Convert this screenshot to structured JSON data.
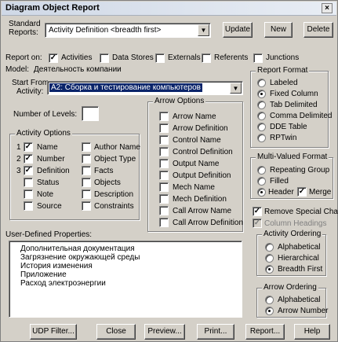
{
  "window": {
    "title": "Diagram Object Report",
    "close": "×"
  },
  "top": {
    "standard_reports_label_1": "Standard",
    "standard_reports_label_2": "Reports:",
    "standard_report_value": "Activity Definition <breadth first>",
    "update": "Update",
    "new": "New",
    "delete": "Delete"
  },
  "report_on": {
    "label": "Report on:",
    "activities": "Activities",
    "data_stores": "Data Stores",
    "externals": "Externals",
    "referents": "Referents",
    "junctions": "Junctions"
  },
  "model": {
    "label": "Model:",
    "value": "Деятельность компании"
  },
  "start_from": {
    "label_1": "Start From",
    "label_2": "Activity:",
    "value": "A2: Сборка и тестирование  компьютеров"
  },
  "levels": {
    "label": "Number of Levels:",
    "value": ""
  },
  "activity_options": {
    "title": "Activity Options",
    "left": [
      {
        "num": "1",
        "label": "Name",
        "checked": true
      },
      {
        "num": "2",
        "label": "Number",
        "checked": true
      },
      {
        "num": "3",
        "label": "Definition",
        "checked": true
      },
      {
        "num": "",
        "label": "Status",
        "checked": false
      },
      {
        "num": "",
        "label": "Note",
        "checked": false
      },
      {
        "num": "",
        "label": "Source",
        "checked": false
      }
    ],
    "right": [
      {
        "label": "Author Name",
        "checked": false
      },
      {
        "label": "Object Type",
        "checked": false
      },
      {
        "label": "Facts",
        "checked": false
      },
      {
        "label": "Objects",
        "checked": false
      },
      {
        "label": "Description",
        "checked": false
      },
      {
        "label": "Constraints",
        "checked": false
      }
    ]
  },
  "arrow_options": {
    "title": "Arrow Options",
    "items": [
      "Arrow Name",
      "Arrow Definition",
      "Control Name",
      "Control Definition",
      "Output Name",
      "Output Definition",
      "Mech Name",
      "Mech Definition",
      "Call Arrow Name",
      "Call Arrow Definition"
    ]
  },
  "report_format": {
    "title": "Report Format",
    "items": [
      "Labeled",
      "Fixed Column",
      "Tab Delimited",
      "Comma Delimited",
      "DDE Table",
      "RPTwin"
    ],
    "selected": "Fixed Column"
  },
  "multi_valued": {
    "title": "Multi-Valued Format",
    "items": [
      "Repeating Group",
      "Filled",
      "Header"
    ],
    "selected": "Header",
    "merge_label": "Merge",
    "merge_checked": true
  },
  "remove_special": {
    "label": "Remove Special Char",
    "checked": true
  },
  "column_headings": {
    "label": "Column Headings",
    "checked": true,
    "disabled": true
  },
  "activity_ordering": {
    "title": "Activity Ordering",
    "items": [
      "Alphabetical",
      "Hierarchical",
      "Breadth First"
    ],
    "selected": "Breadth First"
  },
  "arrow_ordering": {
    "title": "Arrow Ordering",
    "items": [
      "Alphabetical",
      "Arrow Number"
    ],
    "selected": "Arrow Number"
  },
  "udp": {
    "label": "User-Defined Properties:",
    "items": [
      "Дополнительная документация",
      "Загрязнение окружающей среды",
      "История изменения",
      "Приложение",
      "Расход электроэнергии"
    ]
  },
  "bottom_buttons": [
    "UDP Filter...",
    "Close",
    "Preview...",
    "Print...",
    "Report...",
    "Help"
  ],
  "check_mark": "✓"
}
